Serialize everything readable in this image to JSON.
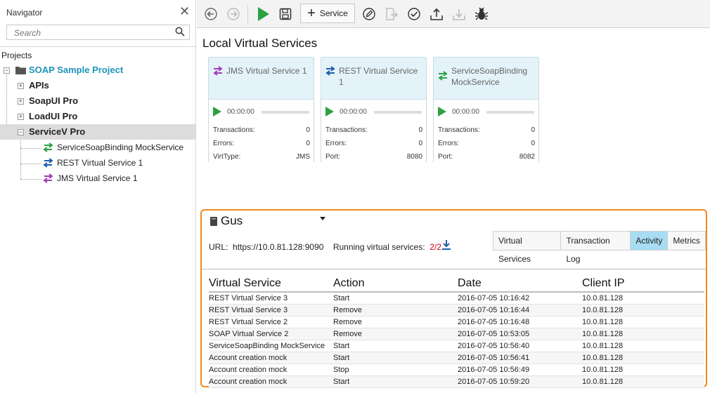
{
  "navigator": {
    "title": "Navigator",
    "search_placeholder": "Search",
    "projects_label": "Projects",
    "project": "SOAP Sample Project",
    "nodes": [
      "APIs",
      "SoapUI Pro",
      "LoadUI Pro",
      "ServiceV Pro"
    ],
    "services": [
      "ServiceSoapBinding MockService",
      "REST Virtual Service 1",
      "JMS Virtual Service 1"
    ]
  },
  "toolbar": {
    "service_label": "Service"
  },
  "main": {
    "title": "Local Virtual Services",
    "cards": [
      {
        "name_lines": [
          "JMS Virtual Service 1",
          ""
        ],
        "icon": "jms-arrows-icon",
        "icon_color": "#a43bb5",
        "time": "00:00:00",
        "rows": [
          [
            "Transactions:",
            "0"
          ],
          [
            "Errors:",
            "0"
          ],
          [
            "VirtType:",
            "JMS"
          ]
        ]
      },
      {
        "name_lines": [
          "REST Virtual Service 1",
          ""
        ],
        "icon": "rest-arrows-icon",
        "icon_color": "#1f5ea8",
        "time": "00:00:00",
        "rows": [
          [
            "Transactions:",
            "0"
          ],
          [
            "Errors:",
            "0"
          ],
          [
            "Port:",
            "8080"
          ]
        ]
      },
      {
        "name_lines": [
          "ServiceSoapBinding",
          "MockService"
        ],
        "icon": "soap-arrows-icon",
        "icon_color": "#2ea043",
        "time": "00:00:00",
        "rows": [
          [
            "Transactions:",
            "0"
          ],
          [
            "Errors:",
            "0"
          ],
          [
            "Port:",
            "8082"
          ]
        ]
      }
    ]
  },
  "server": {
    "name": "Gus",
    "url_label": "URL:",
    "url": "https://10.0.81.128:9090",
    "running_label": "Running virtual services:",
    "running_count": "2/2",
    "tabs": [
      "Virtual Services",
      "Transaction Log",
      "Activity",
      "Metrics"
    ],
    "active_tab": "Activity",
    "columns": [
      "Virtual Service",
      "Action",
      "Date",
      "Client IP"
    ],
    "rows": [
      [
        "REST Virtual Service 3",
        "Start",
        "2016-07-05 10:16:42",
        "10.0.81.128"
      ],
      [
        "REST Virtual Service 3",
        "Remove",
        "2016-07-05 10:16:44",
        "10.0.81.128"
      ],
      [
        "REST Virtual Service 2",
        "Remove",
        "2016-07-05 10:16:48",
        "10.0.81.128"
      ],
      [
        "SOAP Virtual Service 2",
        "Remove",
        "2016-07-05 10:53:05",
        "10.0.81.128"
      ],
      [
        "ServiceSoapBinding MockService",
        "Start",
        "2016-07-05 10:56:40",
        "10.0.81.128"
      ],
      [
        "Account creation mock",
        "Start",
        "2016-07-05 10:56:41",
        "10.0.81.128"
      ],
      [
        "Account creation mock",
        "Stop",
        "2016-07-05 10:56:49",
        "10.0.81.128"
      ],
      [
        "Account creation mock",
        "Start",
        "2016-07-05 10:59:20",
        "10.0.81.128"
      ]
    ]
  },
  "colors": {
    "accent": "#f08a1c",
    "active_tab": "#a8dcf2",
    "project_text": "#1c94b8",
    "play": "#2ea043",
    "running_count": "#d0021b"
  }
}
